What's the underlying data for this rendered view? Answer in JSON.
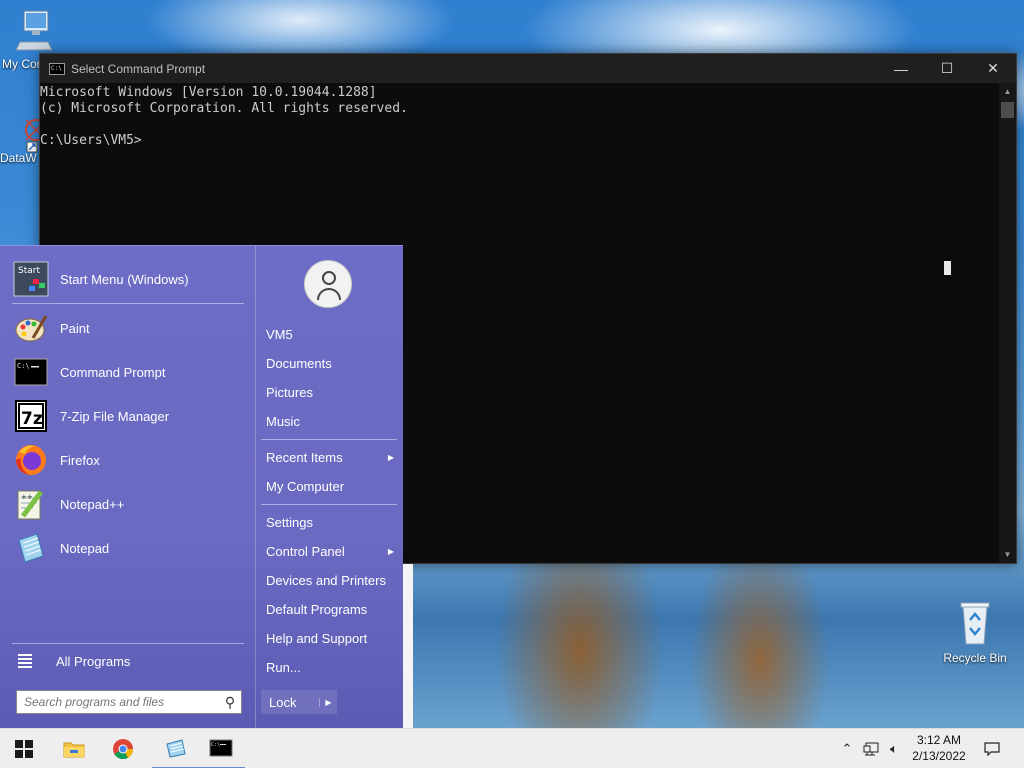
{
  "desktop": {
    "icons": [
      {
        "label": "My Computer",
        "icon": "computer-icon"
      },
      {
        "label": "DataW",
        "icon": "datawrapper-icon"
      },
      {
        "label": "Recycle Bin",
        "icon": "recycle-bin-icon"
      }
    ]
  },
  "console": {
    "title": "Select Command Prompt",
    "lines": [
      "Microsoft Windows [Version 10.0.19044.1288]",
      "(c) Microsoft Corporation. All rights reserved.",
      "",
      "C:\\Users\\VM5>"
    ],
    "minimize": "—",
    "maximize": "☐",
    "close": "✕"
  },
  "start_menu": {
    "pinned": [
      {
        "label": "Start Menu (Windows)",
        "icon": "start-menu-icon"
      },
      {
        "label": "Paint",
        "icon": "paint-icon"
      },
      {
        "label": "Command Prompt",
        "icon": "command-prompt-icon"
      },
      {
        "label": "7-Zip File Manager",
        "icon": "7zip-icon"
      },
      {
        "label": "Firefox",
        "icon": "firefox-icon"
      },
      {
        "label": "Notepad++",
        "icon": "notepadpp-icon"
      },
      {
        "label": "Notepad",
        "icon": "notepad-icon"
      }
    ],
    "all_programs": "All Programs",
    "search_placeholder": "Search programs and files",
    "right": {
      "user": "VM5",
      "group1": [
        "Documents",
        "Pictures",
        "Music"
      ],
      "recent_items": "Recent Items",
      "my_computer": "My Computer",
      "settings": "Settings",
      "control_panel": "Control Panel",
      "group3": [
        "Devices and Printers",
        "Default Programs",
        "Help and Support",
        "Run..."
      ],
      "lock": "Lock"
    }
  },
  "taskbar": {
    "apps": [
      "start-button",
      "file-explorer",
      "chrome",
      "notepad",
      "command-prompt"
    ],
    "time": "3:12 AM",
    "date": "2/13/2022"
  },
  "colors": {
    "start_menu_bg": "#6b6ac2",
    "console_bg": "#0c0c0c",
    "taskbar_bg": "#eeeeee"
  }
}
